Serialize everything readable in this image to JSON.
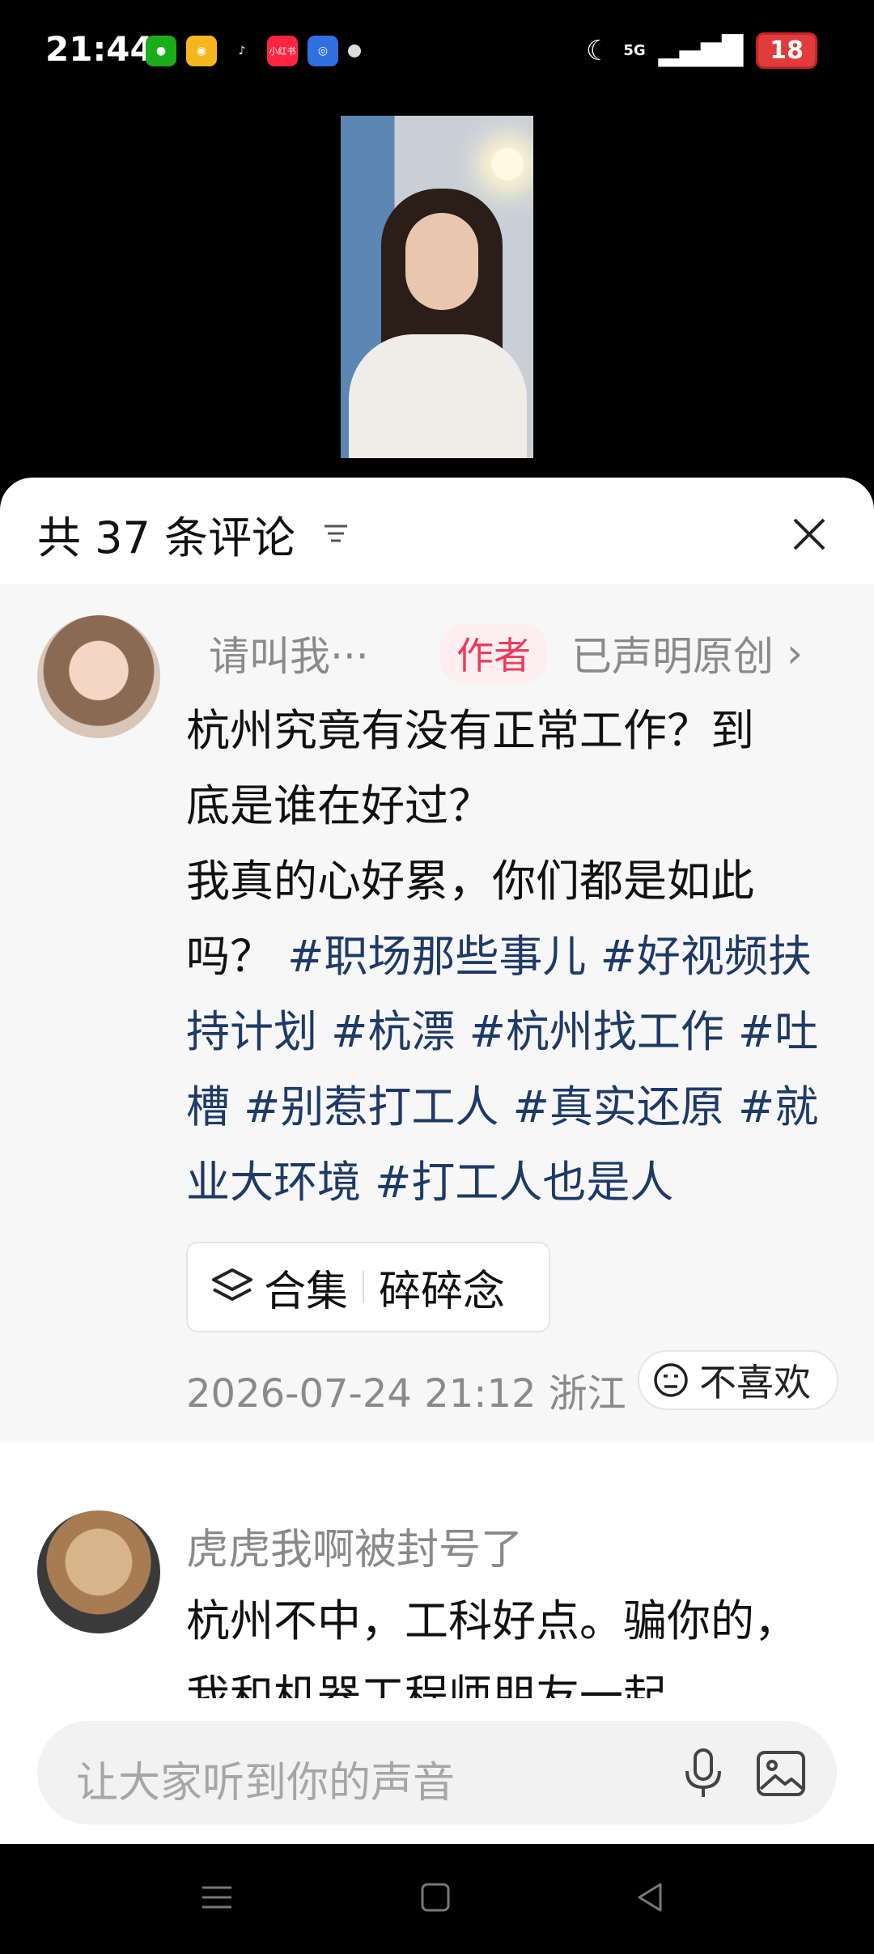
{
  "status_bar": {
    "time": "21:44",
    "network": "5G",
    "battery": "18",
    "apps": [
      "wechat-icon",
      "weibo-icon",
      "tiktok-icon",
      "xiaohongshu-icon",
      "app-icon"
    ],
    "xiaohongshu_label": "小红书"
  },
  "comments_panel": {
    "title": "共 37 条评论"
  },
  "author_post": {
    "username": "请叫我···",
    "author_tag": "作者",
    "declared_original": "已声明原创",
    "text_lines": [
      "杭州究竟有没有正常工作？到",
      "底是谁在好过？",
      "我真的心好累，你们都是如此"
    ],
    "text_tail": "吗？",
    "hashtags": [
      "#职场那些事儿",
      "#好视频扶持计划",
      "#杭漂",
      "#杭州找工作",
      "#吐槽",
      "#别惹打工人",
      "#真实还原",
      "#就业大环境",
      "#打工人也是人"
    ],
    "collection_label": "合集",
    "collection_name": "碎碎念",
    "datetime": "2026-07-24 21:12 浙江",
    "dislike_label": "不喜欢"
  },
  "comment_2": {
    "username": "虎虎我啊被封号了",
    "text": "杭州不中，工科好点。骗你的，我和机器工程师朋友一起"
  },
  "input": {
    "placeholder": "让大家听到你的声音"
  },
  "colors": {
    "hashtag": "#1e3a66",
    "author_tag": "#ee3b5b",
    "battery": "#e23b3b"
  }
}
